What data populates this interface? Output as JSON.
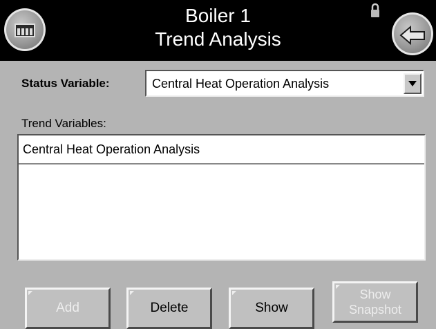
{
  "header": {
    "title_line1": "Boiler 1",
    "title_line2": "Trend Analysis",
    "home_icon": "building-icon",
    "back_icon": "back-arrow-icon",
    "lock_icon": "padlock-icon"
  },
  "status": {
    "label": "Status Variable:",
    "selected_value": "Central Heat Operation Analysis"
  },
  "trend": {
    "label": "Trend Variables:",
    "items": [
      "Central Heat Operation Analysis"
    ]
  },
  "buttons": {
    "add": "Add",
    "delete": "Delete",
    "show": "Show",
    "snapshot_line1": "Show",
    "snapshot_line2": "Snapshot"
  },
  "colors": {
    "background": "#b4b4b4",
    "header": "#000000",
    "disabled_text": "#ededed"
  }
}
